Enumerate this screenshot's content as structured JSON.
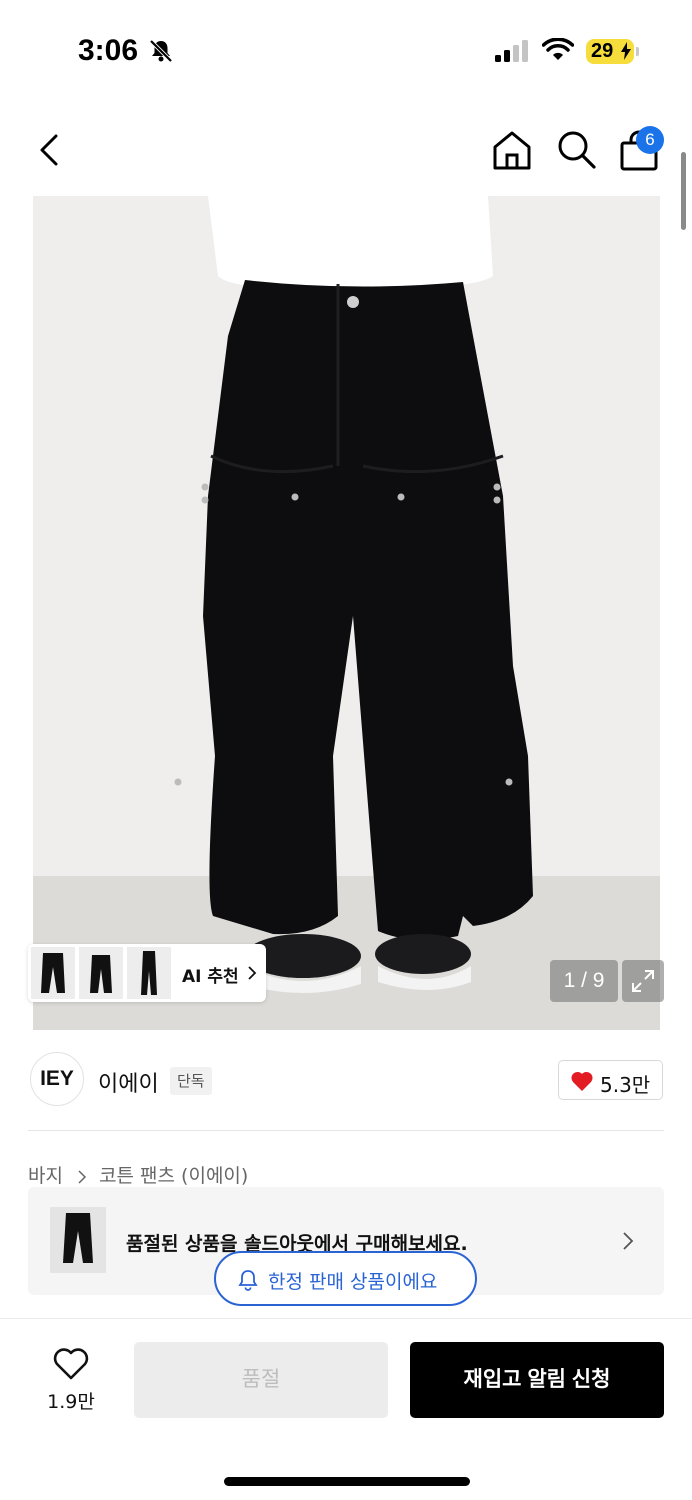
{
  "status_bar": {
    "time": "3:06",
    "battery_level": "29",
    "icons": [
      "bell-slash-icon",
      "signal-icon",
      "wifi-icon",
      "battery-icon"
    ]
  },
  "nav": {
    "icons": [
      "back-arrow-icon",
      "home-icon",
      "search-icon",
      "shopping-bag-icon"
    ],
    "cart_count": "6",
    "badge_color": "#1a73e8"
  },
  "gallery": {
    "ai_recommend_label": "AI 추천",
    "page_counter": "1 / 9",
    "thumbnail_count": 3
  },
  "brand": {
    "logo_text": "IEY",
    "name": "이에이",
    "tag": "단독",
    "likes": "5.3만",
    "like_color": "#e31b23"
  },
  "breadcrumb": {
    "category": "바지",
    "subcategory": "코튼 팬츠 (이에이)"
  },
  "soldout_notice": {
    "text": "품절된 상품을 솔드아웃에서 구매해보세요."
  },
  "limited_badge": {
    "text": "한정 판매 상품이에요",
    "accent_color": "#2a63d4"
  },
  "bottom_bar": {
    "wishlist_count": "1.9만",
    "soldout_label": "품절",
    "restock_label": "재입고 알림 신청"
  }
}
